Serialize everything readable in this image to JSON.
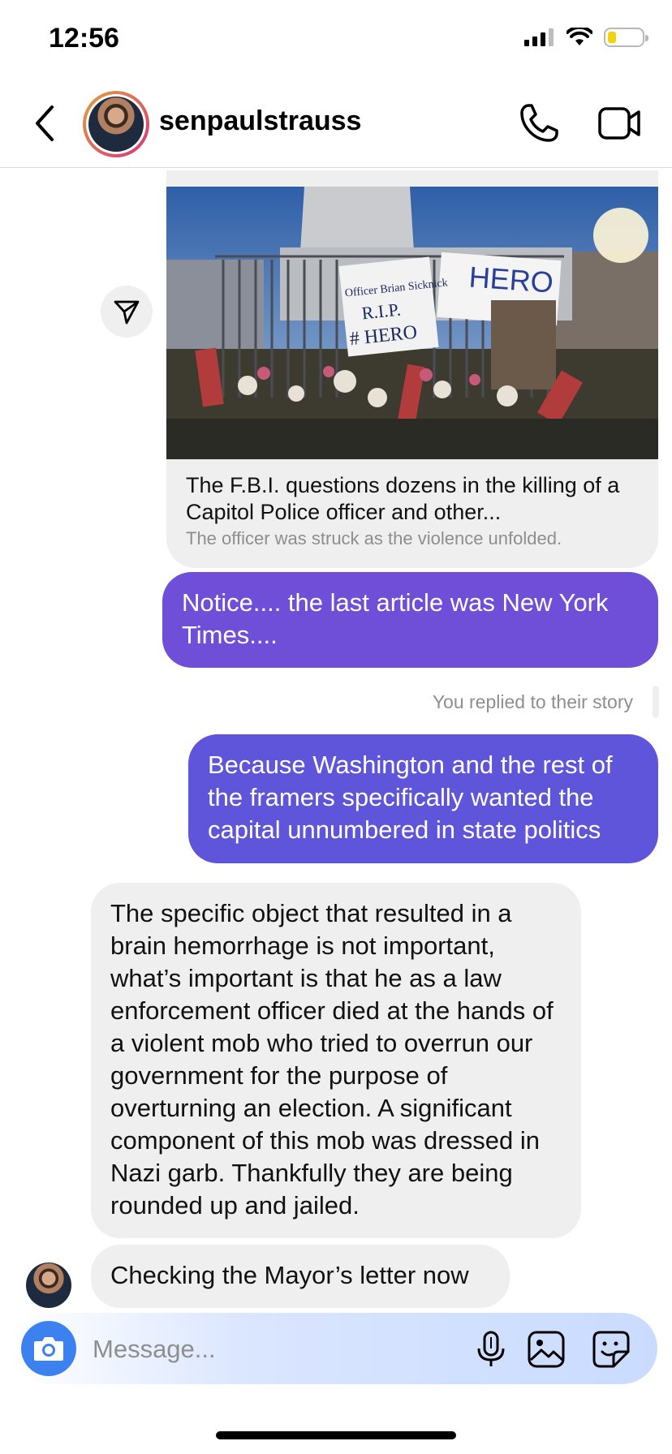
{
  "status_bar": {
    "time": "12:56",
    "battery_level": 0.25
  },
  "header": {
    "username": "senpaulstrauss"
  },
  "shared_card": {
    "image_text": [
      "Officer Brian Sicknick",
      "R.I.P.",
      "# HERO",
      "HERO"
    ],
    "title": "The F.B.I. questions dozens in the killing of a Capitol Police officer and other...",
    "subtitle": "The officer was struck as the violence unfolded."
  },
  "messages": [
    {
      "direction": "outgoing",
      "text": "Notice.... the last article was New York Times...."
    },
    {
      "direction": "outgoing",
      "text": "Because Washington and the rest of the framers specifically wanted the capital unnumbered in state politics"
    },
    {
      "direction": "incoming",
      "text": "The specific object that resulted in a brain hemorrhage is not important, what’s important is that he as a law enforcement officer died at the hands of a violent mob who tried to overrun our government for the purpose of overturning an election. A significant component of this mob was dressed in Nazi garb.  Thankfully they are being rounded up and jailed."
    },
    {
      "direction": "incoming",
      "text": "Checking the Mayor’s letter now"
    }
  ],
  "story_reply_label": "You replied to their story",
  "composer": {
    "placeholder": "Message..."
  },
  "icons": [
    "back-chevron-icon",
    "phone-icon",
    "video-camera-icon",
    "send-icon",
    "camera-icon",
    "microphone-icon",
    "gallery-icon",
    "sticker-icon"
  ],
  "colors": {
    "outgoing_bubble": "#6f4fd7",
    "outgoing_bubble_2": "#5f55db",
    "incoming_bubble": "#efefef",
    "camera_button": "#3b82f0"
  }
}
